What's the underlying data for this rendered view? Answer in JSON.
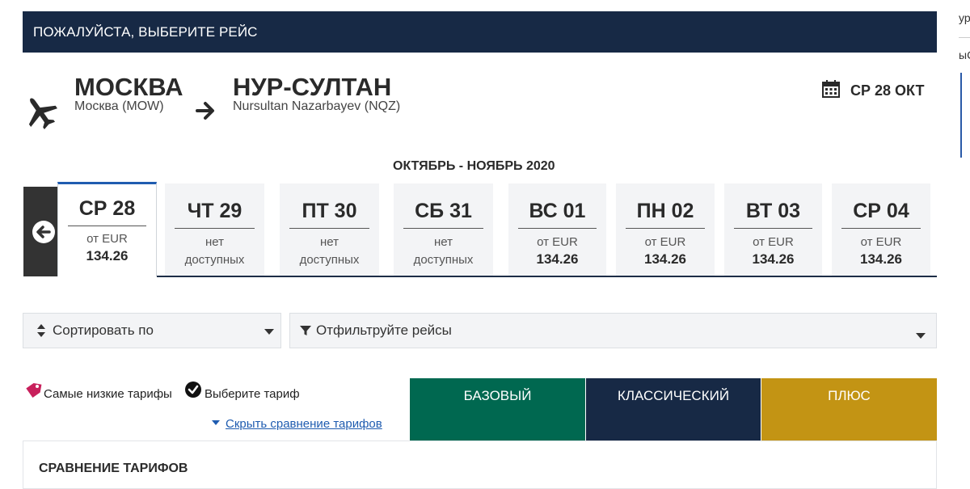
{
  "header": {
    "title": "ПОЖАЛУЙСТА, ВЫБЕРИТЕ РЕЙС"
  },
  "edge": {
    "text_top": "ур",
    "text_mid": "ыС"
  },
  "route": {
    "origin_city": "МОСКВА",
    "origin_airport": "Москва (MOW)",
    "destination_city": "НУР-СУЛТАН",
    "destination_airport": "Nursultan Nazarbayev (NQZ)",
    "selected_date": "СР 28 ОКТ"
  },
  "calendar": {
    "month_label": "ОКТЯБРЬ - НОЯБРЬ 2020",
    "days": [
      {
        "name": "СР 28",
        "from": "от EUR",
        "price": "134.26"
      },
      {
        "name": "ЧТ 29",
        "line1": "нет",
        "line2": "доступных"
      },
      {
        "name": "ПТ 30",
        "line1": "нет",
        "line2": "доступных"
      },
      {
        "name": "СБ 31",
        "line1": "нет",
        "line2": "доступных"
      },
      {
        "name": "ВС 01",
        "from": "от EUR",
        "price": "134.26"
      },
      {
        "name": "ПН 02",
        "from": "от EUR",
        "price": "134.26"
      },
      {
        "name": "ВТ 03",
        "from": "от EUR",
        "price": "134.26"
      },
      {
        "name": "СР 04",
        "from": "от EUR",
        "price": "134.26"
      }
    ]
  },
  "controls": {
    "sort_label": "Сортировать по",
    "filter_label": "Отфильтруйте рейсы"
  },
  "legend": {
    "lowest": "Самые низкие тарифы",
    "choose": "Выберите тариф",
    "hide_link": "Скрыть сравнение тарифов"
  },
  "fares": [
    {
      "label": "БАЗОВЫЙ",
      "color": "#006850"
    },
    {
      "label": "КЛАССИЧЕСКИЙ",
      "color": "#172945"
    },
    {
      "label": "ПЛЮС",
      "color": "#c39414"
    }
  ],
  "comparison": {
    "title": "СРАВНЕНИЕ ТАРИФОВ"
  },
  "colors": {
    "header_bg": "#172945",
    "accent_link": "#1f5cb0",
    "tag_pink": "#c8205c"
  }
}
